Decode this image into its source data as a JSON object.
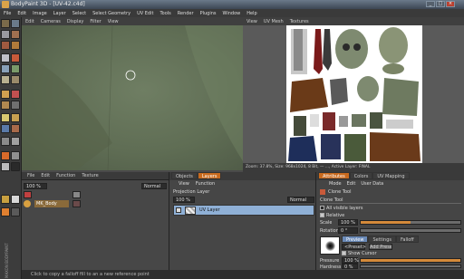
{
  "window": {
    "title": "BodyPaint 3D - [UV-42.c4d]",
    "min": "_",
    "max": "□",
    "close": "×"
  },
  "menu": [
    "File",
    "Edit",
    "Image",
    "Layer",
    "Select",
    "Select Geometry",
    "UV Edit",
    "Tools",
    "Render",
    "Plugins",
    "Window",
    "Help"
  ],
  "viewport": {
    "menu": [
      "Edit",
      "Cameras",
      "Display",
      "Filter",
      "View"
    ]
  },
  "uv_view": {
    "menu": [
      "View",
      "UV Mesh",
      "Textures"
    ]
  },
  "status": {
    "text": "Zoom: 37.8%, Size: 968x1024, 8 Bit, — ..., Active Layer: FINAL"
  },
  "timeline": {
    "menu": [
      "File",
      "Edit",
      "Function",
      "Texture"
    ],
    "frame_value": "100 %",
    "mode": "Normal",
    "object_label": "MK_Body"
  },
  "layers_panel": {
    "tabs": [
      "Objects",
      "Layers"
    ],
    "menu": [
      "View",
      "Function"
    ],
    "projection_label": "Projection Layer",
    "field_value": "100 %",
    "blend_mode": "Normal",
    "layer_name": "UV Layer"
  },
  "attr_panel": {
    "tabs": [
      "Attributes",
      "Colors",
      "UV Mapping"
    ],
    "menu": [
      "Mode",
      "Edit",
      "User Data"
    ],
    "tool_title": "Clone Tool",
    "section": "Clone Tool",
    "opt_visible": "All visible layers",
    "opt_relative": "Relative",
    "scale_label": "Scale",
    "scale_value": "100 %",
    "scale_fraction": 0.5,
    "rotation_label": "Rotation",
    "rotation_value": "0 °",
    "sub_tabs": [
      "Preview",
      "Settings",
      "Falloff"
    ],
    "preset": "<Preset>",
    "add_preset": "Add Preset",
    "show_cursor": "Show Cursor",
    "pressure_label": "Pressure",
    "pressure_value": "100 %",
    "pressure_fraction": 1.0,
    "hardness_label": "Hardness",
    "hardness_value": "0 %",
    "hardness_fraction": 0.0
  },
  "bottom": {
    "hint": "Click to copy a falloff fill to an a new reference point"
  },
  "side_logo": "MAXON BODYPAINT 3D"
}
